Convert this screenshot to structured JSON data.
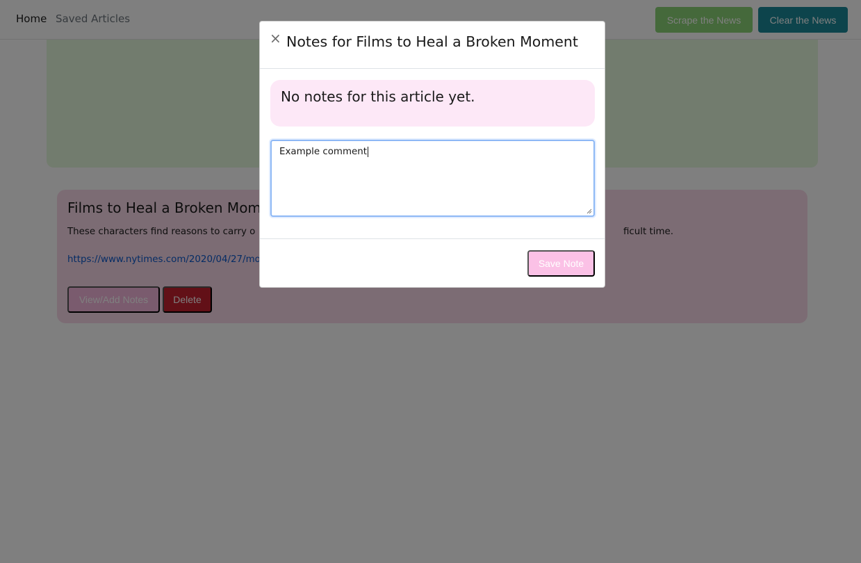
{
  "navbar": {
    "home_label": "Home",
    "saved_label": "Saved Articles",
    "scrape_label": "Scrape the News",
    "clear_label": "Clear the News"
  },
  "article": {
    "title": "Films to Heal a Broken Mom",
    "summary": "These characters find reasons to carry o",
    "summary_tail": "ficult time.",
    "link": "https://www.nytimes.com/2020/04/27/mo",
    "notes_button": "View/Add Notes",
    "delete_button": "Delete"
  },
  "modal": {
    "close_symbol": "×",
    "title": "Notes for Films to Heal a Broken Moment",
    "empty_message": "No notes for this article yet.",
    "textarea_value": "Example comment",
    "save_button": "Save Note"
  },
  "colors": {
    "scrape_button": "#8bd276",
    "clear_button": "#1a8898",
    "jumbotron": "#e5f9dd",
    "article_card": "#f8d9e9",
    "notes_button": "#f4b6dc",
    "delete_button": "#c4202f",
    "note_alert": "#fde8f7",
    "save_button": "#fbc1e6"
  },
  "icons": {
    "close": "close-icon",
    "resize": "resize-grip-icon"
  }
}
